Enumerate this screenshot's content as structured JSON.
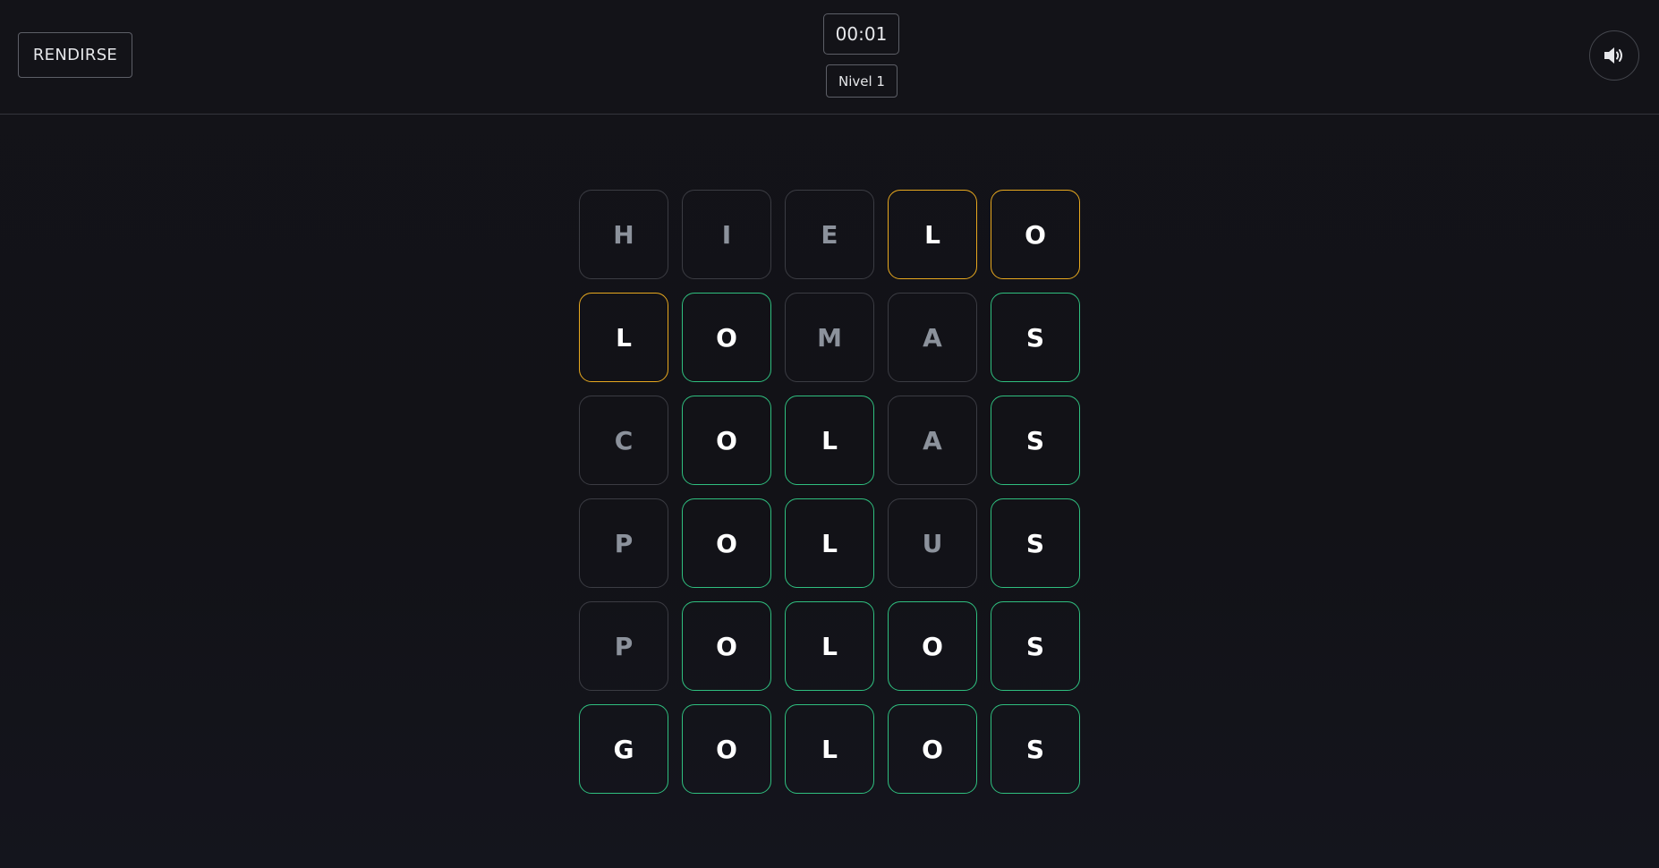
{
  "header": {
    "giveup_label": "RENDIRSE",
    "timer": "00:01",
    "level": "Nivel 1",
    "sound_icon": "speaker-volume-icon"
  },
  "colors": {
    "correct": "#2fbf7f",
    "present": "#e7a81f",
    "absent": "#3b3c43"
  },
  "board": {
    "rows": [
      [
        {
          "letter": "H",
          "state": "absent"
        },
        {
          "letter": "I",
          "state": "absent"
        },
        {
          "letter": "E",
          "state": "absent"
        },
        {
          "letter": "L",
          "state": "present"
        },
        {
          "letter": "O",
          "state": "present"
        }
      ],
      [
        {
          "letter": "L",
          "state": "present"
        },
        {
          "letter": "O",
          "state": "correct"
        },
        {
          "letter": "M",
          "state": "absent"
        },
        {
          "letter": "A",
          "state": "absent"
        },
        {
          "letter": "S",
          "state": "correct"
        }
      ],
      [
        {
          "letter": "C",
          "state": "absent"
        },
        {
          "letter": "O",
          "state": "correct"
        },
        {
          "letter": "L",
          "state": "correct"
        },
        {
          "letter": "A",
          "state": "absent"
        },
        {
          "letter": "S",
          "state": "correct"
        }
      ],
      [
        {
          "letter": "P",
          "state": "absent"
        },
        {
          "letter": "O",
          "state": "correct"
        },
        {
          "letter": "L",
          "state": "correct"
        },
        {
          "letter": "U",
          "state": "absent"
        },
        {
          "letter": "S",
          "state": "correct"
        }
      ],
      [
        {
          "letter": "P",
          "state": "absent"
        },
        {
          "letter": "O",
          "state": "correct"
        },
        {
          "letter": "L",
          "state": "correct"
        },
        {
          "letter": "O",
          "state": "correct"
        },
        {
          "letter": "S",
          "state": "correct"
        }
      ],
      [
        {
          "letter": "G",
          "state": "correct"
        },
        {
          "letter": "O",
          "state": "correct"
        },
        {
          "letter": "L",
          "state": "correct"
        },
        {
          "letter": "O",
          "state": "correct"
        },
        {
          "letter": "S",
          "state": "correct"
        }
      ]
    ]
  }
}
